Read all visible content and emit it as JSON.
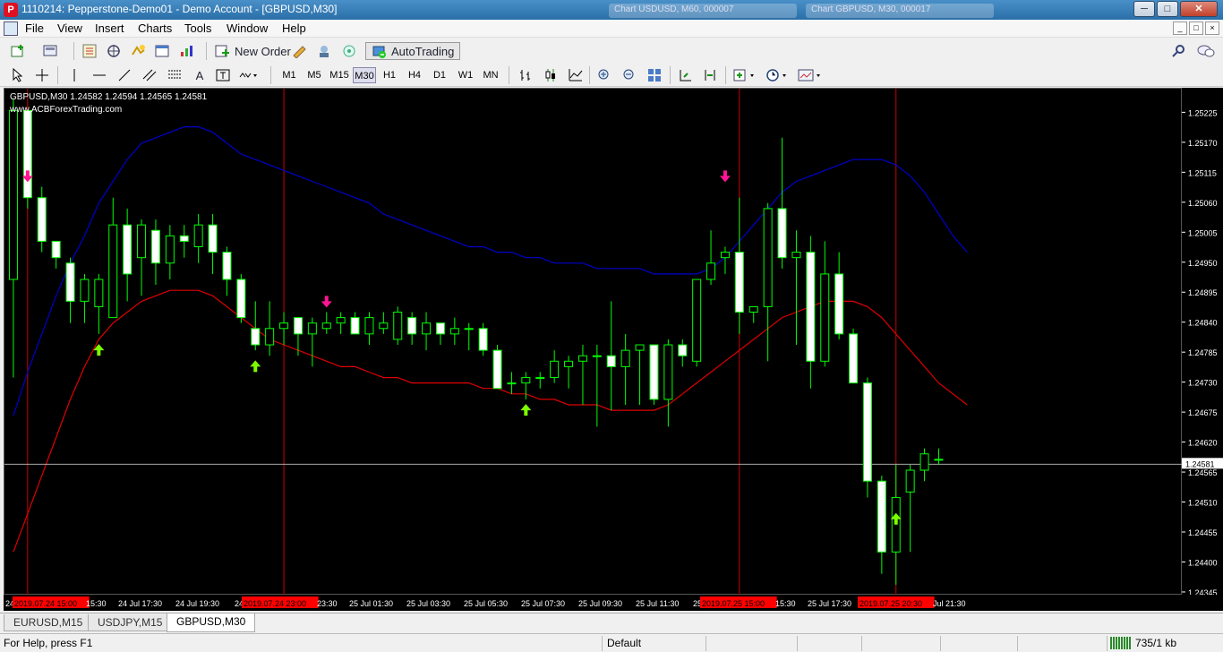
{
  "window": {
    "title": "1110214: Pepperstone-Demo01 - Demo Account - [GBPUSD,M30]",
    "app_icon": "P",
    "ghost_tabs": [
      "Chart USDUSD, M60, 000007",
      "Chart GBPUSD, M30, 000017"
    ],
    "controls": {
      "minimize": "─",
      "maximize": "□",
      "close": "✕"
    }
  },
  "menu": {
    "items": [
      "File",
      "View",
      "Insert",
      "Charts",
      "Tools",
      "Window",
      "Help"
    ],
    "mdi_controls": [
      "_",
      "□",
      "×"
    ]
  },
  "toolbar1": {
    "new_order_label": "New Order",
    "autotrading_label": "AutoTrading"
  },
  "toolbar2": {
    "timeframes": [
      "M1",
      "M5",
      "M15",
      "M30",
      "H1",
      "H4",
      "D1",
      "W1",
      "MN"
    ],
    "active_timeframe": "M30"
  },
  "chart": {
    "symbol_line": "GBPUSD,M30  1.24582 1.24594 1.24565 1.24581",
    "watermark": "www.ACBForexTrading.com",
    "colors": {
      "background": "#000000",
      "bull_body": "#000000",
      "bear_body": "#ffffff",
      "wick": "#00ff00",
      "upper_band": "#0000cc",
      "lower_band": "#e00000",
      "vline": "#cc0000",
      "up_arrow": "#7cfc00",
      "down_arrow": "#ff1493",
      "bid_line": "#c0c0c0"
    },
    "current_price": "1.24581"
  },
  "chart_data": {
    "type": "candlestick",
    "symbol": "GBPUSD",
    "timeframe": "M30",
    "ohlc_header": {
      "open": 1.24582,
      "high": 1.24594,
      "low": 1.24565,
      "close": 1.24581
    },
    "ylim": [
      1.2434,
      1.2527
    ],
    "price_ticks": [
      "1.25225",
      "1.25170",
      "1.25115",
      "1.25060",
      "1.25005",
      "1.24950",
      "1.24895",
      "1.24840",
      "1.24785",
      "1.24730",
      "1.24675",
      "1.24620",
      "1.24565",
      "1.24510",
      "1.24455",
      "1.24400",
      "1.24345"
    ],
    "time_labels": [
      "24",
      "2019.07.24 15:00",
      "15:30",
      "24 Jul 17:30",
      "24 Jul 19:30",
      "24",
      "2019.07.24 23:00",
      "23:30",
      "25 Jul 01:30",
      "25 Jul 03:30",
      "25 Jul 05:30",
      "25 Jul 07:30",
      "25 Jul 09:30",
      "25 Jul 11:30",
      "25",
      "2019.07.25 15:00",
      "15:30",
      "25 Jul 17:30",
      "2019.07.25 20:30",
      "Jul 21:30"
    ],
    "highlighted_time_labels": [
      "2019.07.24 15:00",
      "2019.07.24 23:00",
      "2019.07.25 15:00",
      "2019.07.25 20:30"
    ],
    "candles": [
      [
        1.2492,
        1.2525,
        1.2474,
        1.2523
      ],
      [
        1.2523,
        1.2523,
        1.2505,
        1.2507
      ],
      [
        1.2507,
        1.2509,
        1.2497,
        1.2499
      ],
      [
        1.2499,
        1.2499,
        1.2494,
        1.2496
      ],
      [
        1.2495,
        1.2496,
        1.2484,
        1.2488
      ],
      [
        1.2488,
        1.2493,
        1.2484,
        1.2492
      ],
      [
        1.2487,
        1.2493,
        1.2482,
        1.2492
      ],
      [
        1.2485,
        1.2507,
        1.2485,
        1.2502
      ],
      [
        1.2502,
        1.2505,
        1.2488,
        1.2493
      ],
      [
        1.2496,
        1.2503,
        1.2489,
        1.2502
      ],
      [
        1.2501,
        1.2503,
        1.2491,
        1.2495
      ],
      [
        1.2495,
        1.2502,
        1.2492,
        1.25
      ],
      [
        1.25,
        1.2502,
        1.2496,
        1.2499
      ],
      [
        1.2498,
        1.2504,
        1.2495,
        1.2502
      ],
      [
        1.2502,
        1.2504,
        1.2493,
        1.2497
      ],
      [
        1.2497,
        1.2498,
        1.2489,
        1.2492
      ],
      [
        1.2492,
        1.2493,
        1.2484,
        1.2485
      ],
      [
        1.2483,
        1.2488,
        1.2479,
        1.248
      ],
      [
        1.248,
        1.2488,
        1.2478,
        1.2483
      ],
      [
        1.2483,
        1.2486,
        1.248,
        1.2484
      ],
      [
        1.2485,
        1.2485,
        1.2478,
        1.2482
      ],
      [
        1.2482,
        1.2485,
        1.2476,
        1.2484
      ],
      [
        1.2483,
        1.2486,
        1.2482,
        1.2484
      ],
      [
        1.2484,
        1.2486,
        1.2482,
        1.2485
      ],
      [
        1.2485,
        1.2486,
        1.2482,
        1.2482
      ],
      [
        1.2482,
        1.2486,
        1.248,
        1.2485
      ],
      [
        1.2483,
        1.2486,
        1.2482,
        1.2484
      ],
      [
        1.2481,
        1.2487,
        1.248,
        1.2486
      ],
      [
        1.2485,
        1.2486,
        1.248,
        1.2482
      ],
      [
        1.2482,
        1.2486,
        1.2479,
        1.2484
      ],
      [
        1.2484,
        1.2484,
        1.248,
        1.2482
      ],
      [
        1.2482,
        1.2485,
        1.248,
        1.2483
      ],
      [
        1.2483,
        1.2484,
        1.2479,
        1.2483
      ],
      [
        1.2483,
        1.2484,
        1.2478,
        1.2479
      ],
      [
        1.2479,
        1.248,
        1.2472,
        1.2472
      ],
      [
        1.2473,
        1.2475,
        1.2471,
        1.2473
      ],
      [
        1.2473,
        1.2475,
        1.247,
        1.2474
      ],
      [
        1.2474,
        1.2475,
        1.2472,
        1.2474
      ],
      [
        1.2474,
        1.2479,
        1.2473,
        1.2477
      ],
      [
        1.2476,
        1.2478,
        1.2472,
        1.2477
      ],
      [
        1.2477,
        1.248,
        1.2469,
        1.2478
      ],
      [
        1.2478,
        1.248,
        1.2465,
        1.2478
      ],
      [
        1.2478,
        1.2488,
        1.2468,
        1.2476
      ],
      [
        1.2476,
        1.2482,
        1.2469,
        1.2479
      ],
      [
        1.2479,
        1.248,
        1.2469,
        1.248
      ],
      [
        1.248,
        1.248,
        1.2469,
        1.247
      ],
      [
        1.247,
        1.2481,
        1.2465,
        1.248
      ],
      [
        1.248,
        1.2481,
        1.2476,
        1.2478
      ],
      [
        1.2477,
        1.2492,
        1.2476,
        1.2492
      ],
      [
        1.2492,
        1.2501,
        1.2491,
        1.2495
      ],
      [
        1.2496,
        1.2498,
        1.2493,
        1.2497
      ],
      [
        1.2497,
        1.2507,
        1.2482,
        1.2486
      ],
      [
        1.2486,
        1.2487,
        1.2484,
        1.2487
      ],
      [
        1.2487,
        1.2506,
        1.2477,
        1.2505
      ],
      [
        1.2505,
        1.2518,
        1.2494,
        1.2496
      ],
      [
        1.2496,
        1.2501,
        1.248,
        1.2497
      ],
      [
        1.2497,
        1.25,
        1.2472,
        1.2477
      ],
      [
        1.2477,
        1.2499,
        1.2476,
        1.2493
      ],
      [
        1.2493,
        1.2497,
        1.2481,
        1.2482
      ],
      [
        1.2482,
        1.2483,
        1.2473,
        1.2473
      ],
      [
        1.2473,
        1.2474,
        1.2452,
        1.2455
      ],
      [
        1.2455,
        1.2456,
        1.2438,
        1.2442
      ],
      [
        1.2442,
        1.2458,
        1.2436,
        1.2452
      ],
      [
        1.2453,
        1.2458,
        1.2442,
        1.2457
      ],
      [
        1.2457,
        1.2461,
        1.2455,
        1.246
      ],
      [
        1.2459,
        1.2461,
        1.2458,
        1.2459
      ]
    ],
    "upper_band": [
      1.2467,
      1.2475,
      1.2482,
      1.2489,
      1.2495,
      1.25,
      1.2506,
      1.251,
      1.2514,
      1.2517,
      1.2518,
      1.2519,
      1.252,
      1.252,
      1.2519,
      1.2517,
      1.2515,
      1.2514,
      1.2513,
      1.2512,
      1.2511,
      1.251,
      1.2509,
      1.2508,
      1.2507,
      1.2506,
      1.2504,
      1.2503,
      1.2502,
      1.2501,
      1.25,
      1.2499,
      1.2498,
      1.2498,
      1.2497,
      1.2497,
      1.2496,
      1.2496,
      1.2495,
      1.2495,
      1.2495,
      1.2494,
      1.2494,
      1.2494,
      1.2494,
      1.2493,
      1.2493,
      1.2493,
      1.2493,
      1.2494,
      1.2496,
      1.2499,
      1.2502,
      1.2505,
      1.2508,
      1.251,
      1.2511,
      1.2512,
      1.2513,
      1.2514,
      1.2514,
      1.2514,
      1.2513,
      1.2511,
      1.2508,
      1.2504,
      1.25,
      1.2497
    ],
    "lower_band": [
      1.2442,
      1.2449,
      1.2456,
      1.2463,
      1.247,
      1.2476,
      1.2481,
      1.2484,
      1.2486,
      1.2488,
      1.2489,
      1.249,
      1.249,
      1.249,
      1.2489,
      1.2487,
      1.2485,
      1.2483,
      1.2481,
      1.248,
      1.2479,
      1.2478,
      1.2477,
      1.2476,
      1.2476,
      1.2475,
      1.2474,
      1.2474,
      1.2473,
      1.2473,
      1.2473,
      1.2473,
      1.2473,
      1.2472,
      1.2472,
      1.2471,
      1.2471,
      1.247,
      1.247,
      1.2469,
      1.2469,
      1.2469,
      1.2468,
      1.2468,
      1.2468,
      1.2468,
      1.2469,
      1.2471,
      1.2473,
      1.2475,
      1.2477,
      1.2479,
      1.2481,
      1.2483,
      1.2485,
      1.2486,
      1.2487,
      1.2488,
      1.2488,
      1.2488,
      1.2487,
      1.2485,
      1.2482,
      1.2479,
      1.2476,
      1.2473,
      1.2471,
      1.2469
    ],
    "up_arrows": [
      {
        "index": 6,
        "price": 1.2479
      },
      {
        "index": 17,
        "price": 1.2476
      },
      {
        "index": 36,
        "price": 1.2468
      },
      {
        "index": 62,
        "price": 1.2448
      }
    ],
    "down_arrows": [
      {
        "index": 1,
        "price": 1.2511
      },
      {
        "index": 22,
        "price": 1.2488
      },
      {
        "index": 50,
        "price": 1.2511
      }
    ],
    "vertical_markers": [
      1,
      19,
      51,
      62
    ]
  },
  "tabs": {
    "items": [
      "EURUSD,M15",
      "USDJPY,M15",
      "GBPUSD,M30"
    ],
    "active": "GBPUSD,M30"
  },
  "status": {
    "help": "For Help, press F1",
    "profile": "Default",
    "traffic": "735/1 kb"
  }
}
